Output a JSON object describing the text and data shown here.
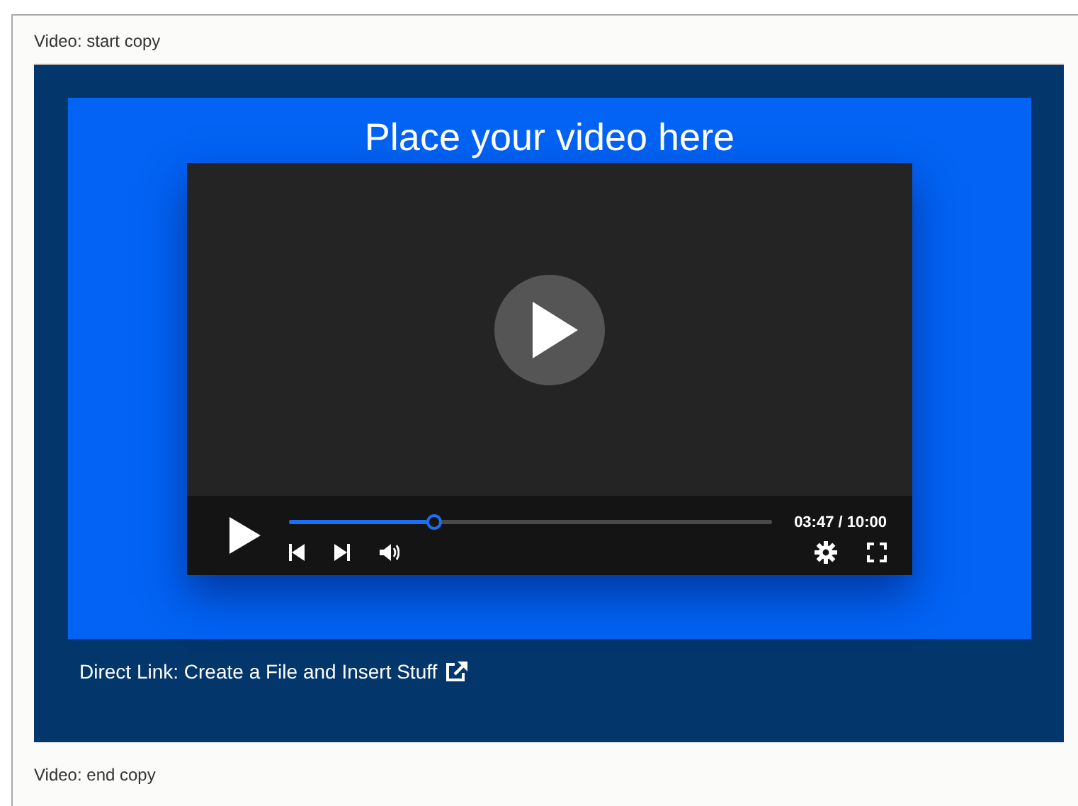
{
  "labels": {
    "start": "Video: start copy",
    "end": "Video: end copy"
  },
  "video": {
    "heading": "Place your video here",
    "time": "03:47 / 10:00",
    "progress": {
      "level": 0.3
    }
  },
  "link": {
    "text": "Direct Link: Create a File and Insert Stuff"
  }
}
